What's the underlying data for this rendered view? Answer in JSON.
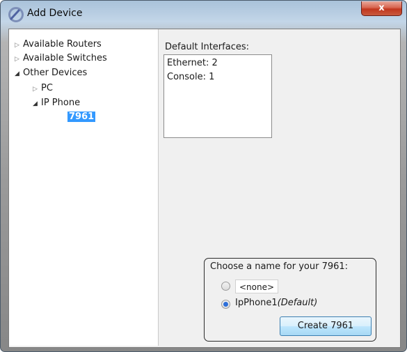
{
  "window": {
    "title": "Add Device",
    "close_label": "x"
  },
  "tree": {
    "items": [
      {
        "label": "Available Routers",
        "state": "collapsed"
      },
      {
        "label": "Available Switches",
        "state": "collapsed"
      },
      {
        "label": "Other Devices",
        "state": "expanded"
      },
      {
        "label": "PC",
        "state": "collapsed"
      },
      {
        "label": "IP Phone",
        "state": "expanded"
      },
      {
        "label": "7961",
        "state": "selected"
      }
    ]
  },
  "interfaces": {
    "label": "Default Interfaces:",
    "items": [
      "Ethernet: 2",
      "Console: 1"
    ]
  },
  "naming": {
    "label": "Choose a name for your 7961:",
    "option_none": "<none>",
    "option_default_name": "IpPhone1",
    "option_default_suffix": "(Default)",
    "selected": "default",
    "create_label": "Create 7961"
  },
  "colors": {
    "selection": "#3399ff",
    "button_border": "#3c7fb1"
  }
}
